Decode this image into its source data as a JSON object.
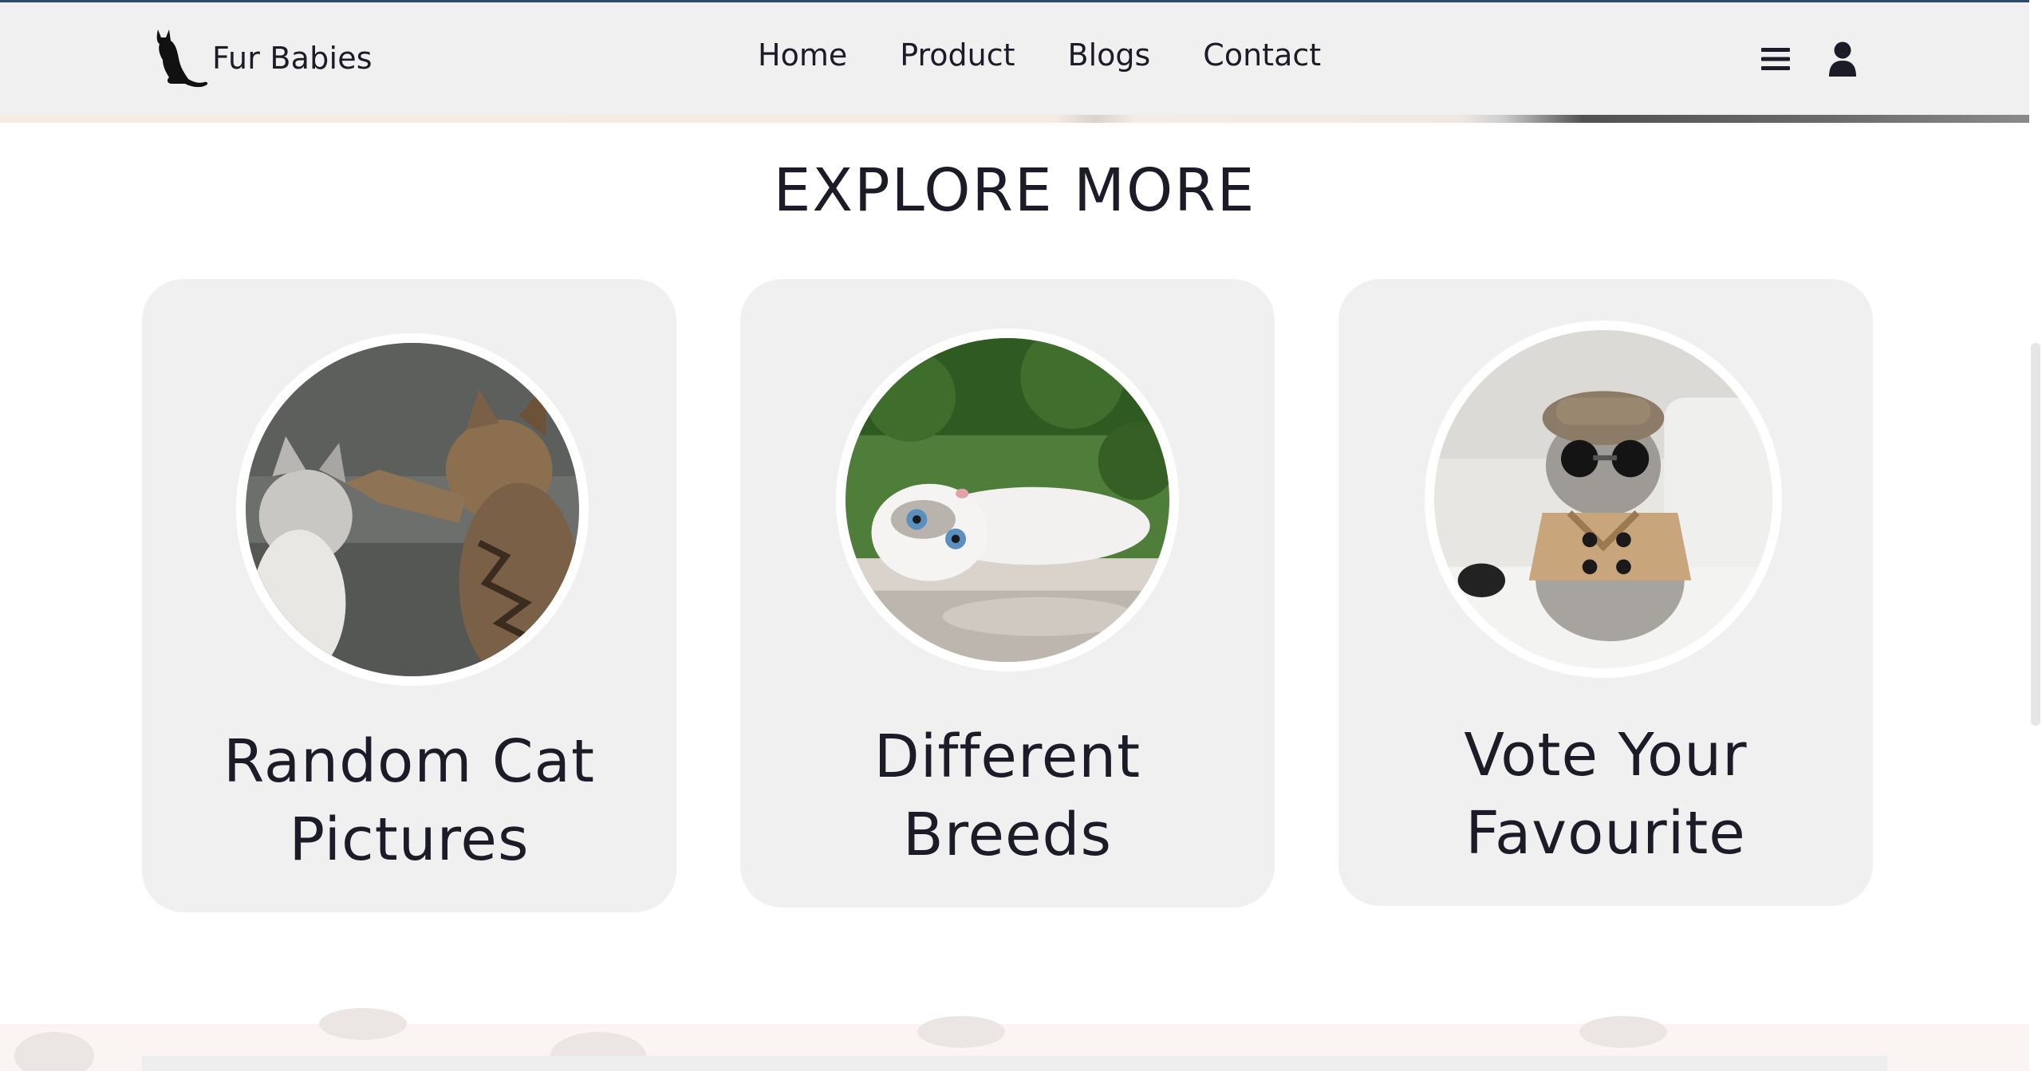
{
  "header": {
    "brand": {
      "name": "Fur Babies",
      "logo_icon": "black-cat-icon"
    },
    "nav": [
      {
        "label": "Home"
      },
      {
        "label": "Product"
      },
      {
        "label": "Blogs"
      },
      {
        "label": "Contact"
      }
    ],
    "icons": [
      "hamburger-menu-icon",
      "user-icon"
    ]
  },
  "explore": {
    "title": "EXPLORE MORE",
    "cards": [
      {
        "line1": "Random Cat",
        "line2": "Pictures",
        "image": "two tabby kittens playing"
      },
      {
        "line1": "Different",
        "line2": "Breeds",
        "image": "white cat lying down outdoors"
      },
      {
        "line1": "Vote Your",
        "line2": "Favourite",
        "image": "cat wearing hat, sunglasses and trench coat"
      }
    ]
  },
  "theme": {
    "nav_background": "#f0f0f0",
    "card_background": "#f0f0f0",
    "text": "#1c1c28"
  }
}
